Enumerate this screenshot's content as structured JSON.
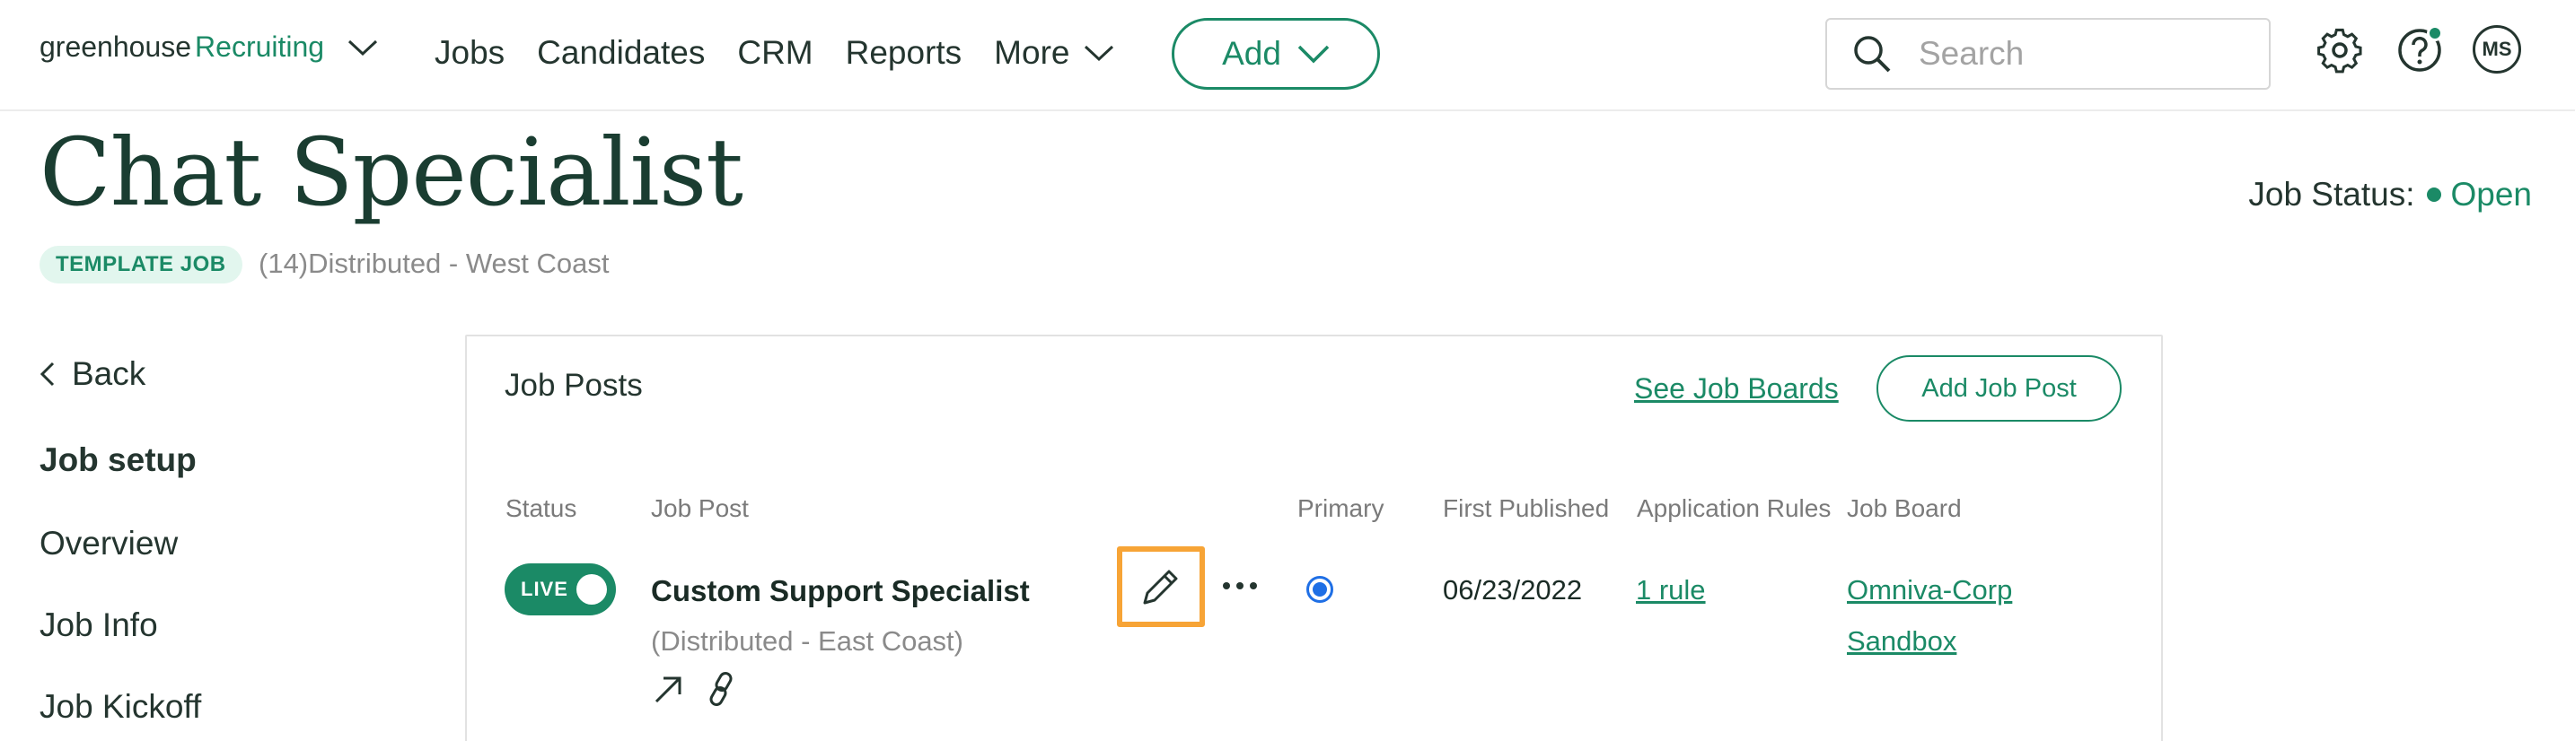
{
  "topnav": {
    "logo_primary": "greenhouse",
    "logo_secondary": "Recruiting",
    "items": [
      {
        "label": "Jobs"
      },
      {
        "label": "Candidates"
      },
      {
        "label": "CRM"
      },
      {
        "label": "Reports"
      },
      {
        "label": "More"
      }
    ],
    "add_label": "Add",
    "search_placeholder": "Search",
    "avatar_initials": "MS"
  },
  "header": {
    "title": "Chat Specialist",
    "badge": "TEMPLATE JOB",
    "subtitle": "(14)Distributed - West Coast",
    "status_label": "Job Status:",
    "status_value": "Open"
  },
  "sidebar": {
    "back_label": "Back",
    "items": [
      {
        "label": "Job setup",
        "active": true
      },
      {
        "label": "Overview"
      },
      {
        "label": "Job Info"
      },
      {
        "label": "Job Kickoff"
      }
    ]
  },
  "job_posts": {
    "title": "Job Posts",
    "see_boards_label": "See Job Boards",
    "add_post_label": "Add Job Post",
    "columns": [
      "Status",
      "Job Post",
      "Primary",
      "First Published",
      "Application Rules",
      "Job Board"
    ],
    "rows": [
      {
        "status": "LIVE",
        "name": "Custom Support Specialist",
        "location": "(Distributed - East Coast)",
        "primary": true,
        "first_published": "06/23/2022",
        "rules": "1 rule",
        "board_line1": "Omniva-Corp",
        "board_line2": "Sandbox"
      }
    ]
  },
  "colors": {
    "accent": "#1b8a66",
    "highlight": "#f7a436",
    "radio": "#1f6fe5"
  }
}
